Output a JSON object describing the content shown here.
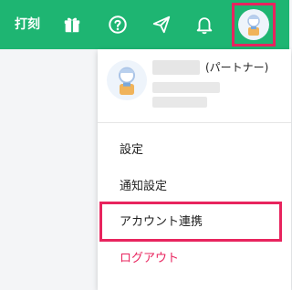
{
  "topbar": {
    "clock_label": "打刻",
    "background": "#1eb572",
    "icons": [
      "gift-icon",
      "help-icon",
      "send-icon",
      "bell-icon",
      "user-avatar"
    ]
  },
  "profile": {
    "role": "(パートナー)"
  },
  "menu": {
    "items": [
      {
        "label": "設定"
      },
      {
        "label": "通知設定"
      },
      {
        "label": "アカウント連携"
      },
      {
        "label": "ログアウト"
      }
    ]
  },
  "colors": {
    "accent": "#1eb572",
    "highlight": "#e8245e",
    "logout": "#e8245e"
  }
}
